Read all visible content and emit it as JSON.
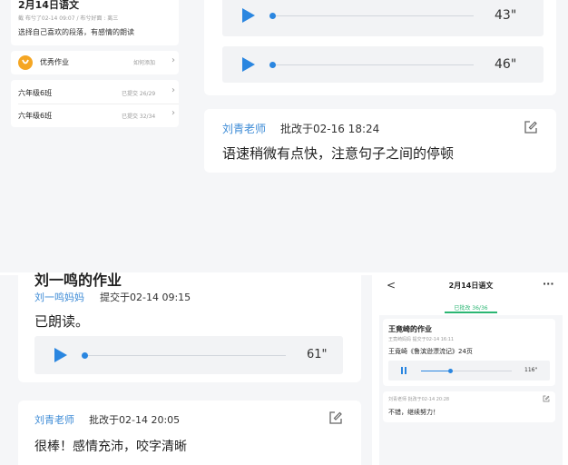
{
  "panel_tl": {
    "title": "2月14日语文",
    "meta": "截 布兮了02-14 09:07 / 布兮好面 : 离三",
    "desc": "选择自己喜欢的段落，有感情的朗读",
    "excellent": {
      "label": "优秀作业",
      "action": "如何添加"
    },
    "classes": [
      {
        "name": "六年级6班",
        "status": "已提交 26/29"
      },
      {
        "name": "六年级6班",
        "status": "已提交 32/34"
      }
    ]
  },
  "panel_tr": {
    "audio": [
      {
        "duration": "43\""
      },
      {
        "duration": "46\""
      }
    ],
    "review": {
      "teacher": "刘青老师",
      "time": "批改于02-16 18:24",
      "comment": "语速稍微有点快，注意句子之间的停顿"
    }
  },
  "panel_bl": {
    "title": "刘一鸣的作业",
    "submitter": "刘一鸣妈妈",
    "time": "提交于02-14 09:15",
    "content": "已朗读。",
    "audio": {
      "duration": "61\""
    },
    "review": {
      "teacher": "刘青老师",
      "time": "批改于02-14 20:05",
      "comment": "很棒！感情充沛，咬字清晰"
    }
  },
  "panel_br": {
    "header": {
      "title": "2月14日语文",
      "back": "<",
      "more": "···"
    },
    "tab": "已批改 36/36",
    "work": {
      "title": "王竟崎的作业",
      "meta": "王竟崎妈妈 提交于02-14 16:11",
      "content": "王竟崎《鲁滨逊漂流记》24页",
      "audio": {
        "duration": "116\""
      }
    },
    "review": {
      "meta": "刘青老师 批改于02-14 20:28",
      "comment": "不错，继续努力！"
    }
  },
  "colors": {
    "accent": "#2a86e0",
    "teacher": "#3d8bd6",
    "badge": "#f5a623",
    "tab": "#2bb673",
    "panel_bg": "#f5f6f8"
  }
}
